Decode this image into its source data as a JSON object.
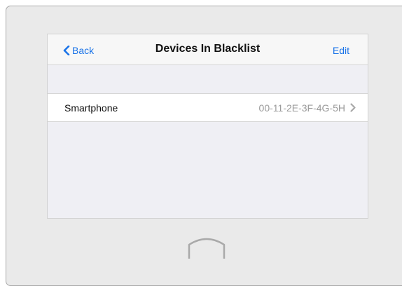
{
  "navbar": {
    "back_label": "Back",
    "title": "Devices In Blacklist",
    "edit_label": "Edit"
  },
  "devices": [
    {
      "name": "Smartphone",
      "mac": "00-11-2E-3F-4G-5H"
    }
  ],
  "colors": {
    "accent": "#1a73e8",
    "background": "#efeff4",
    "frame": "#eaeaea"
  },
  "icons": {
    "back": "chevron-left-icon",
    "row": "chevron-right-icon",
    "home": "home-arch-icon"
  }
}
